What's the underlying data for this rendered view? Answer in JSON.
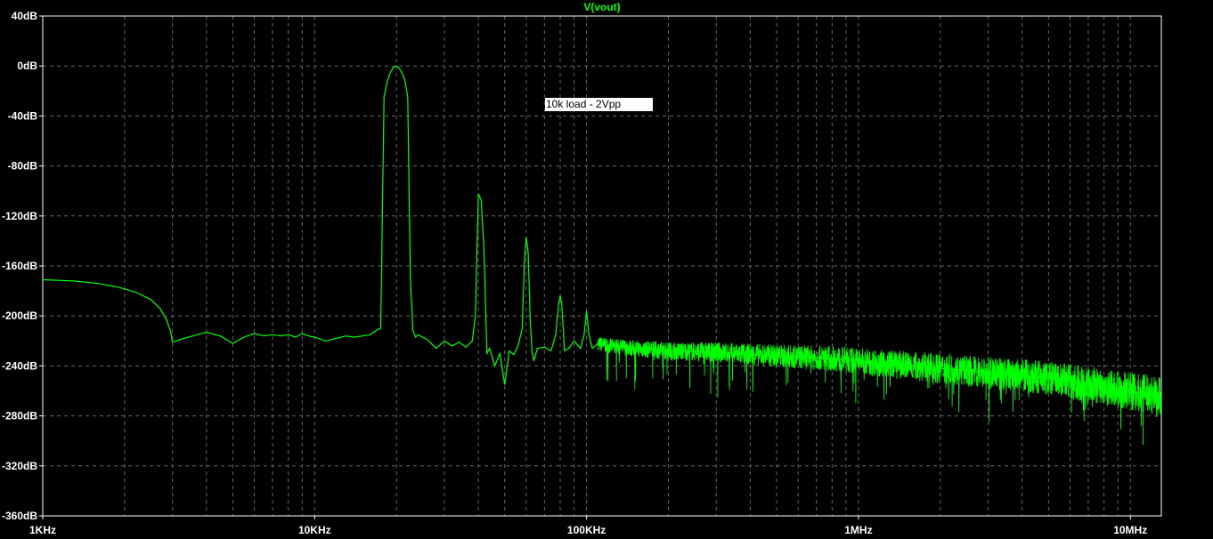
{
  "chart_data": {
    "type": "line",
    "title": "V(vout)",
    "x_scale": "log",
    "xlim_hz": [
      1000,
      13000000
    ],
    "ylim_db": [
      -360,
      40
    ],
    "x_ticks": [
      {
        "value": 1000,
        "label": "1KHz"
      },
      {
        "value": 10000,
        "label": "10KHz"
      },
      {
        "value": 100000,
        "label": "100KHz"
      },
      {
        "value": 1000000,
        "label": "1MHz"
      },
      {
        "value": 10000000,
        "label": "10MHz"
      }
    ],
    "y_ticks": [
      {
        "value": 40,
        "label": "40dB"
      },
      {
        "value": 0,
        "label": "0dB"
      },
      {
        "value": -40,
        "label": "-40dB"
      },
      {
        "value": -80,
        "label": "-80dB"
      },
      {
        "value": -120,
        "label": "-120dB"
      },
      {
        "value": -160,
        "label": "-160dB"
      },
      {
        "value": -200,
        "label": "-200dB"
      },
      {
        "value": -240,
        "label": "-240dB"
      },
      {
        "value": -280,
        "label": "-280dB"
      },
      {
        "value": -320,
        "label": "-320dB"
      },
      {
        "value": -360,
        "label": "-360dB"
      }
    ],
    "grid": true,
    "colors": {
      "trace": "#00ff00",
      "grid": "#666666",
      "frame": "#ffffff",
      "background": "#000000"
    },
    "annotation": "10k load - 2Vpp",
    "series": [
      {
        "name": "V(vout)",
        "x": [
          1000,
          1300,
          1600,
          1900,
          2200,
          2500,
          2700,
          2850,
          2950,
          3000,
          3300,
          3700,
          4000,
          4500,
          5000,
          5500,
          6000,
          6500,
          7000,
          7500,
          8000,
          8500,
          9000,
          9500,
          10000,
          11000,
          12000,
          13000,
          14000,
          15000,
          16000,
          17000,
          17500,
          18000,
          18500,
          19000,
          19500,
          20000,
          20500,
          21000,
          21500,
          22000,
          22500,
          23000,
          23500,
          24000,
          26000,
          28000,
          30000,
          32000,
          34000,
          36000,
          38000,
          39000,
          40000,
          41000,
          42000,
          43000,
          44000,
          46000,
          48000,
          50000,
          52000,
          54000,
          56000,
          58000,
          59000,
          60000,
          61000,
          62000,
          63000,
          64000,
          66000,
          70000,
          74000,
          77000,
          79000,
          80000,
          81000,
          83000,
          86000,
          90000,
          95000,
          98000,
          100000,
          102000,
          105000,
          110000,
          120000,
          150000,
          200000,
          300000,
          500000,
          800000,
          1000000,
          2000000,
          5000000,
          10000000,
          13000000
        ],
        "y": [
          -171,
          -172,
          -174,
          -177,
          -181,
          -187,
          -194,
          -203,
          -212,
          -221,
          -218,
          -215,
          -213,
          -216,
          -222,
          -217,
          -214,
          -216,
          -215,
          -216,
          -215,
          -217,
          -214,
          -216,
          -217,
          -220,
          -218,
          -216,
          -217,
          -216,
          -215,
          -211,
          -210,
          -25,
          -12,
          -5,
          -1,
          0,
          -2,
          -6,
          -12,
          -25,
          -170,
          -212,
          -217,
          -215,
          -219,
          -226,
          -220,
          -224,
          -221,
          -225,
          -220,
          -200,
          -102,
          -108,
          -150,
          -230,
          -226,
          -240,
          -230,
          -255,
          -228,
          -231,
          -224,
          -210,
          -160,
          -137,
          -150,
          -200,
          -228,
          -236,
          -226,
          -225,
          -228,
          -215,
          -190,
          -184,
          -190,
          -228,
          -226,
          -220,
          -226,
          -215,
          -196,
          -215,
          -226,
          -222,
          -224,
          -226,
          -228,
          -229,
          -232,
          -234,
          -236,
          -242,
          -250,
          -260,
          -264
        ]
      }
    ]
  }
}
